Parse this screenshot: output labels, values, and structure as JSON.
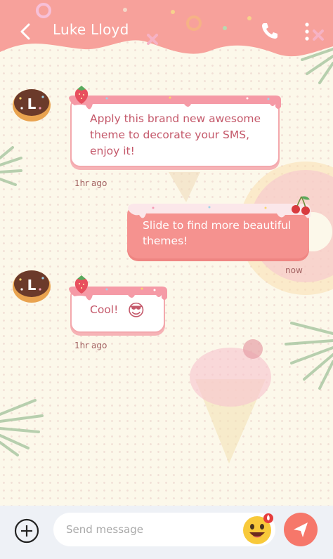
{
  "header": {
    "title": "Luke Lloyd"
  },
  "messages": [
    {
      "direction": "incoming",
      "lines": [
        "Apply this brand new awesome",
        "theme to decorate your SMS,",
        "enjoy it!"
      ],
      "time": "1hr ago"
    },
    {
      "direction": "outgoing",
      "lines": [
        "Slide to find more beautiful",
        "themes!"
      ],
      "time": "now"
    },
    {
      "direction": "incoming",
      "lines": [
        "Cool!"
      ],
      "emoji": "😎",
      "time": "1hr ago"
    }
  ],
  "avatar_letter": "L",
  "composer": {
    "placeholder": "Send message"
  },
  "colors": {
    "header": "#f7a19b",
    "bubble_out": "#f5928f",
    "accent": "#f6776a",
    "text_in": "#c4586a"
  }
}
